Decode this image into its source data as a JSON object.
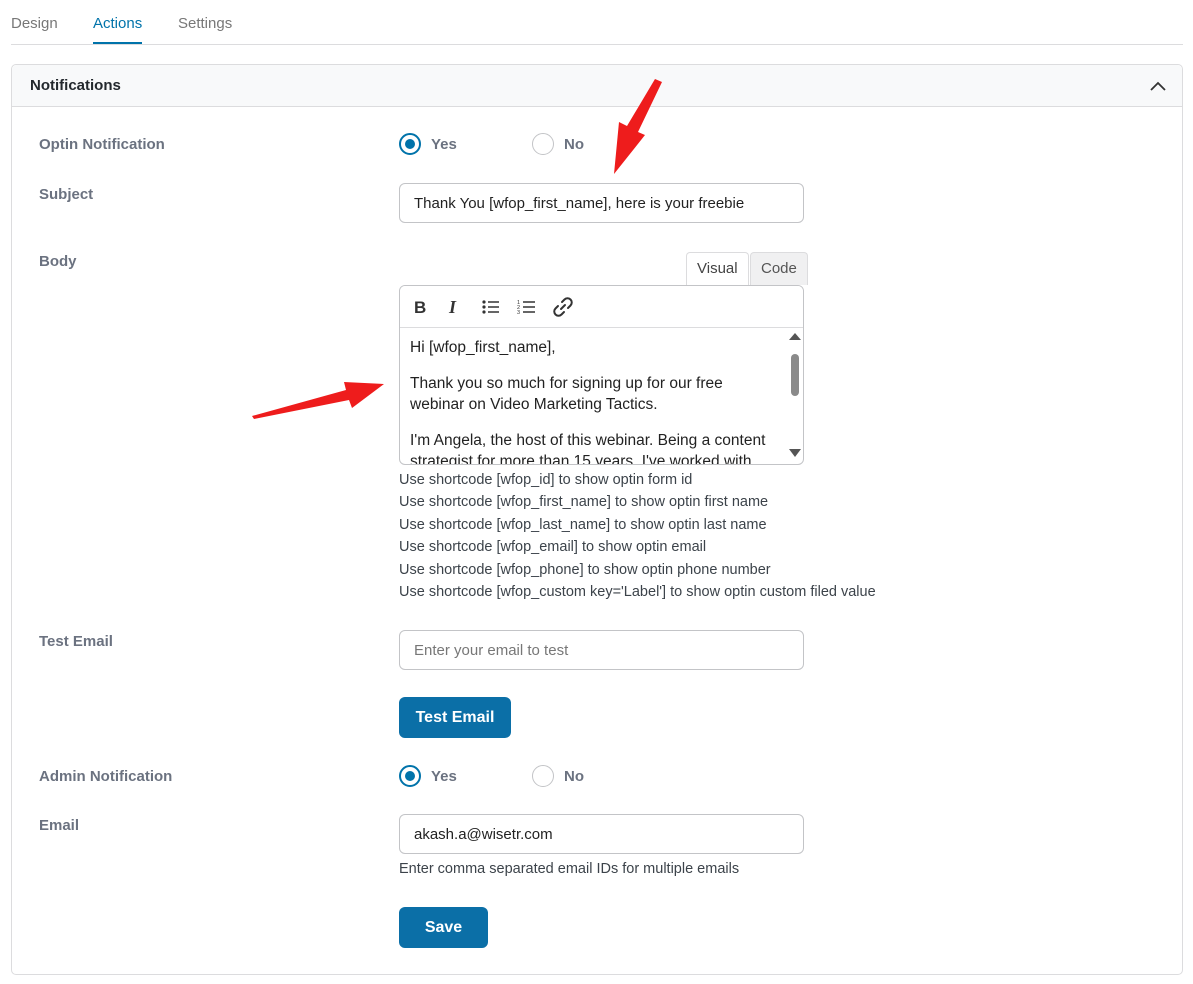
{
  "tabs": [
    {
      "label": "Design"
    },
    {
      "label": "Actions"
    },
    {
      "label": "Settings"
    }
  ],
  "panel": {
    "title": "Notifications"
  },
  "optin_notification": {
    "label": "Optin Notification",
    "yes": "Yes",
    "no": "No",
    "selected": "Yes"
  },
  "subject": {
    "label": "Subject",
    "value": "Thank You [wfop_first_name], here is your freebie"
  },
  "body": {
    "label": "Body",
    "tab_visual": "Visual",
    "tab_code": "Code",
    "paragraphs": [
      "Hi [wfop_first_name],",
      "Thank you so much for signing up for our free webinar on Video Marketing Tactics.",
      "I'm Angela, the host of this webinar. Being a content strategist for more than 15 years, I've worked with"
    ]
  },
  "shortcodes": [
    "Use shortcode [wfop_id] to show optin form id",
    "Use shortcode [wfop_first_name] to show optin first name",
    "Use shortcode [wfop_last_name] to show optin last name",
    "Use shortcode [wfop_email] to show optin email",
    "Use shortcode [wfop_phone] to show optin phone number",
    "Use shortcode [wfop_custom key='Label'] to show optin custom filed value"
  ],
  "test_email": {
    "label": "Test Email",
    "placeholder": "Enter your email to test",
    "button": "Test Email"
  },
  "admin_notification": {
    "label": "Admin Notification",
    "yes": "Yes",
    "no": "No",
    "selected": "Yes"
  },
  "email": {
    "label": "Email",
    "value": "akash.a@wisetr.com",
    "hint": "Enter comma separated email IDs for multiple emails"
  },
  "save_button": "Save",
  "colors": {
    "accent": "#0073aa",
    "button": "#0b6fa7",
    "annotation_arrow": "#ee1c1c"
  },
  "icons": [
    "chevron-up-icon",
    "bold-icon",
    "italic-icon",
    "bullet-list-icon",
    "numbered-list-icon",
    "link-icon",
    "arrow-annotation"
  ]
}
